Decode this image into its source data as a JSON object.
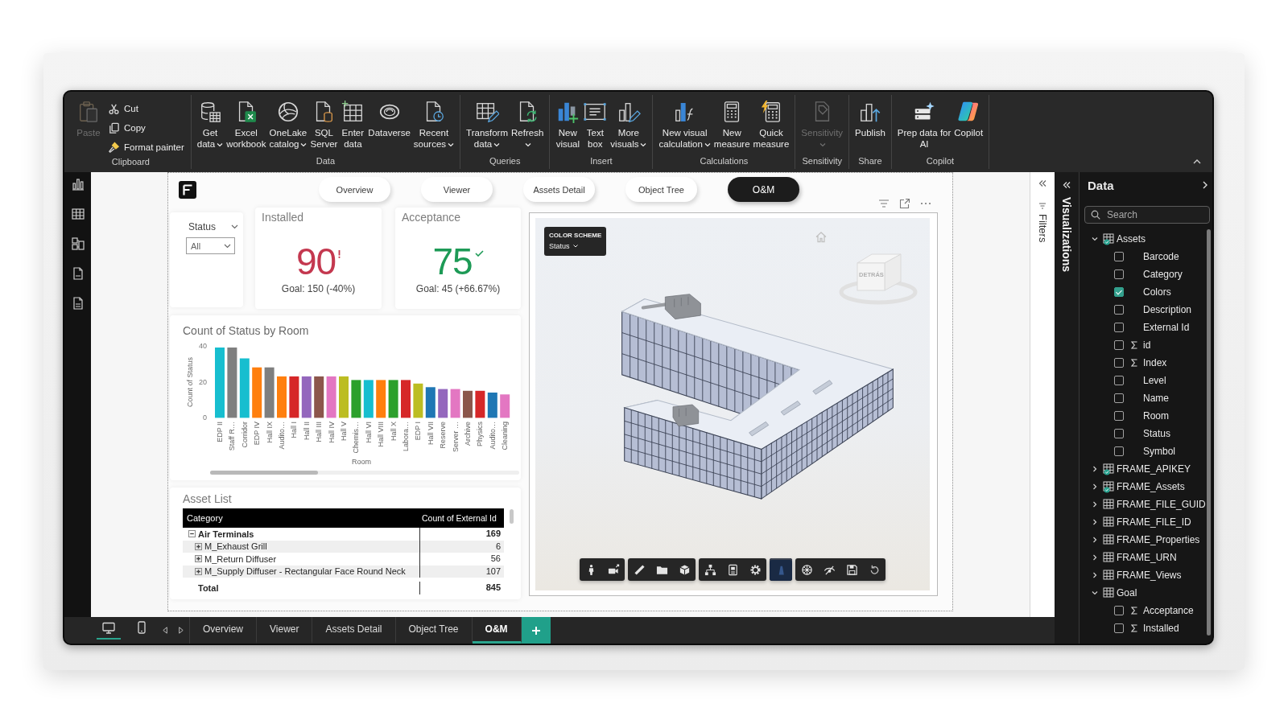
{
  "ribbon": {
    "groups": [
      {
        "label": "Clipboard",
        "items": [
          {
            "label": "Paste",
            "kind": "large",
            "disabled": true,
            "dropdown": false
          },
          {
            "label": "Cut",
            "kind": "small",
            "disabled": false,
            "dropdown": false
          },
          {
            "label": "Copy",
            "kind": "small",
            "disabled": false,
            "dropdown": false
          },
          {
            "label": "Format painter",
            "kind": "small",
            "disabled": false,
            "dropdown": false
          }
        ]
      },
      {
        "label": "Data",
        "items": [
          {
            "label": "Get\ndata",
            "kind": "large",
            "disabled": false,
            "dropdown": true
          },
          {
            "label": "Excel\nworkbook",
            "kind": "large",
            "disabled": false,
            "dropdown": false
          },
          {
            "label": "OneLake\ncatalog",
            "kind": "large",
            "disabled": false,
            "dropdown": true
          },
          {
            "label": "SQL\nServer",
            "kind": "large",
            "disabled": false,
            "dropdown": false
          },
          {
            "label": "Enter\ndata",
            "kind": "large",
            "disabled": false,
            "dropdown": false
          },
          {
            "label": "Dataverse",
            "kind": "large",
            "disabled": false,
            "dropdown": false
          },
          {
            "label": "Recent\nsources",
            "kind": "large",
            "disabled": false,
            "dropdown": true
          }
        ]
      },
      {
        "label": "Queries",
        "items": [
          {
            "label": "Transform\ndata",
            "kind": "large",
            "disabled": false,
            "dropdown": true
          },
          {
            "label": "Refresh",
            "kind": "large",
            "disabled": false,
            "dropdown": true
          }
        ]
      },
      {
        "label": "Insert",
        "items": [
          {
            "label": "New\nvisual",
            "kind": "large",
            "disabled": false,
            "dropdown": false
          },
          {
            "label": "Text\nbox",
            "kind": "large",
            "disabled": false,
            "dropdown": false
          },
          {
            "label": "More\nvisuals",
            "kind": "large",
            "disabled": false,
            "dropdown": true
          }
        ]
      },
      {
        "label": "Calculations",
        "items": [
          {
            "label": "New visual\ncalculation",
            "kind": "large",
            "disabled": false,
            "dropdown": true
          },
          {
            "label": "New\nmeasure",
            "kind": "large",
            "disabled": false,
            "dropdown": false
          },
          {
            "label": "Quick\nmeasure",
            "kind": "large",
            "disabled": false,
            "dropdown": false
          }
        ]
      },
      {
        "label": "Sensitivity",
        "items": [
          {
            "label": "Sensitivity",
            "kind": "large",
            "disabled": true,
            "dropdown": true
          }
        ]
      },
      {
        "label": "Share",
        "items": [
          {
            "label": "Publish",
            "kind": "large",
            "disabled": false,
            "dropdown": false
          }
        ]
      },
      {
        "label": "Copilot",
        "items": [
          {
            "label": "Prep data for\nAI",
            "kind": "large",
            "disabled": false,
            "dropdown": false
          },
          {
            "label": "Copilot",
            "kind": "large",
            "disabled": false,
            "dropdown": false
          }
        ]
      }
    ]
  },
  "report": {
    "nav": [
      {
        "label": "Overview",
        "selected": false
      },
      {
        "label": "Viewer",
        "selected": false
      },
      {
        "label": "Assets Detail",
        "selected": false
      },
      {
        "label": "Object Tree",
        "selected": false
      },
      {
        "label": "O&M",
        "selected": true
      }
    ],
    "slicer": {
      "title": "Status",
      "value": "All"
    },
    "kpis": [
      {
        "title": "Installed",
        "value": "90",
        "goal": "Goal: 150 (-40%)",
        "kind": "alert",
        "color": "#c4384f"
      },
      {
        "title": "Acceptance",
        "value": "75",
        "goal": "Goal: 45 (+66.67%)",
        "kind": "ok",
        "color": "#1d9a56"
      }
    ],
    "chart": {
      "chart_data": {
        "type": "bar",
        "title": "Count of Status by Room",
        "xlabel": "Room",
        "ylabel": "Count of Status",
        "categories": [
          "EDP II",
          "Staff R…",
          "Corridor",
          "EDP IV",
          "Hall IX",
          "Audito…",
          "Hall I",
          "Hall II",
          "Hall III",
          "Hall IV",
          "Hall V",
          "Chemis…",
          "Hall VI",
          "Hall VIII",
          "Hall X",
          "Labora…",
          "EDP I",
          "Hall VII",
          "Reserve",
          "Server …",
          "Archive",
          "Physics",
          "Audito…",
          "Cleaning"
        ],
        "values": [
          39,
          39,
          33,
          28,
          28,
          23,
          23,
          23,
          23,
          23,
          23,
          21,
          21,
          21,
          21,
          21,
          19,
          17,
          16,
          16,
          15,
          15,
          14,
          13
        ],
        "colors": [
          "#17becf",
          "#7f7f7f",
          "#17becf",
          "#ff7f0e",
          "#7f7f7f",
          "#ff7f0e",
          "#d62728",
          "#9467bd",
          "#8c564b",
          "#e377c2",
          "#bcbd22",
          "#2ca02c",
          "#17becf",
          "#ff7f0e",
          "#2ca02c",
          "#d62728",
          "#bcbd22",
          "#1f77b4",
          "#9467bd",
          "#e377c2",
          "#8c564b",
          "#d62728",
          "#1f77b4",
          "#e377c2"
        ],
        "ylim": [
          0,
          40
        ],
        "yticks": [
          0,
          20,
          40
        ]
      }
    },
    "asset_list": {
      "title": "Asset List",
      "columns": [
        "Category",
        "Count of External Id"
      ],
      "rows": [
        {
          "category": "Air Terminals",
          "count": "169",
          "expanded": true,
          "children": [
            {
              "category": "M_Exhaust Grill",
              "count": "6",
              "expanded": false
            },
            {
              "category": "M_Return Diffuser",
              "count": "56",
              "expanded": false
            },
            {
              "category": "M_Supply Diffuser - Rectangular Face Round Neck",
              "count": "107",
              "expanded": false
            }
          ]
        }
      ],
      "total": {
        "label": "Total",
        "count": "845"
      }
    },
    "viewer": {
      "color_scheme": {
        "label": "COLOR SCHEME",
        "value": "Status"
      },
      "view_cube": {
        "label": "DETRÁS"
      },
      "toolbar": {
        "groups": [
          {
            "buttons": [
              {
                "selected": false
              },
              {
                "selected": false
              }
            ]
          },
          {
            "buttons": [
              {
                "selected": false
              },
              {
                "selected": false
              },
              {
                "selected": false
              }
            ]
          },
          {
            "buttons": [
              {
                "selected": false
              },
              {
                "selected": false
              },
              {
                "selected": false
              }
            ]
          },
          {
            "buttons": [
              {
                "selected": true
              }
            ]
          },
          {
            "buttons": [
              {
                "selected": false
              },
              {
                "selected": false
              },
              {
                "selected": false
              },
              {
                "selected": false
              }
            ]
          }
        ]
      }
    }
  },
  "panes": {
    "filters": {
      "title": "Filters"
    },
    "visualizations": {
      "title": "Visualizations"
    },
    "data": {
      "title": "Data",
      "search": {
        "placeholder": "Search"
      },
      "tables": [
        {
          "name": "Assets",
          "expanded": true,
          "in_use": true,
          "children": [
            {
              "name": "Barcode",
              "checked": false,
              "kind": "text"
            },
            {
              "name": "Category",
              "checked": false,
              "kind": "text"
            },
            {
              "name": "Colors",
              "checked": true,
              "kind": "text"
            },
            {
              "name": "Description",
              "checked": false,
              "kind": "text"
            },
            {
              "name": "External Id",
              "checked": false,
              "kind": "text"
            },
            {
              "name": "id",
              "checked": false,
              "kind": "numeric"
            },
            {
              "name": "Index",
              "checked": false,
              "kind": "numeric"
            },
            {
              "name": "Level",
              "checked": false,
              "kind": "text"
            },
            {
              "name": "Name",
              "checked": false,
              "kind": "text"
            },
            {
              "name": "Room",
              "checked": false,
              "kind": "text"
            },
            {
              "name": "Status",
              "checked": false,
              "kind": "text"
            },
            {
              "name": "Symbol",
              "checked": false,
              "kind": "text"
            }
          ]
        },
        {
          "name": "FRAME_APIKEY",
          "expanded": false,
          "in_use": true
        },
        {
          "name": "FRAME_Assets",
          "expanded": false,
          "in_use": true
        },
        {
          "name": "FRAME_FILE_GUID",
          "expanded": false,
          "in_use": false
        },
        {
          "name": "FRAME_FILE_ID",
          "expanded": false,
          "in_use": false
        },
        {
          "name": "FRAME_Properties",
          "expanded": false,
          "in_use": false
        },
        {
          "name": "FRAME_URN",
          "expanded": false,
          "in_use": false
        },
        {
          "name": "FRAME_Views",
          "expanded": false,
          "in_use": false
        },
        {
          "name": "Goal",
          "expanded": true,
          "in_use": false,
          "children": [
            {
              "name": "Acceptance",
              "checked": false,
              "kind": "numeric"
            },
            {
              "name": "Installed",
              "checked": false,
              "kind": "numeric"
            }
          ]
        }
      ]
    }
  },
  "page_bar": {
    "views": [
      {
        "selected": true
      },
      {
        "selected": false
      }
    ],
    "tabs": [
      {
        "label": "Overview",
        "selected": false
      },
      {
        "label": "Viewer",
        "selected": false
      },
      {
        "label": "Assets Detail",
        "selected": false
      },
      {
        "label": "Object Tree",
        "selected": false
      },
      {
        "label": "O&M",
        "selected": true
      }
    ]
  }
}
